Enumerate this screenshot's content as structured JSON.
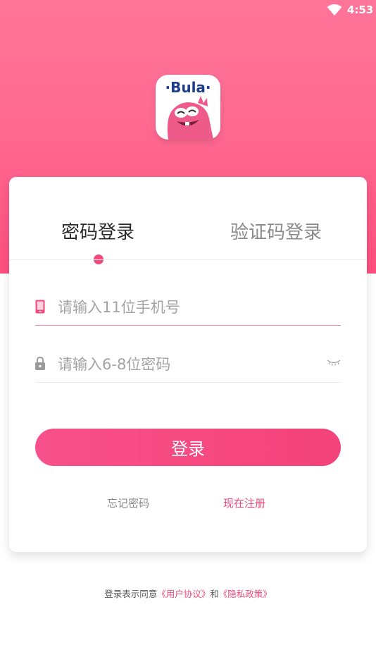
{
  "status_bar": {
    "time": "4:53"
  },
  "logo": {
    "text": "·Bula·"
  },
  "tabs": [
    {
      "label": "密码登录",
      "active": true
    },
    {
      "label": "验证码登录",
      "active": false
    }
  ],
  "phone_field": {
    "placeholder": "请输入11位手机号",
    "value": ""
  },
  "password_field": {
    "placeholder": "请输入6-8位密码",
    "value": ""
  },
  "login_button": {
    "label": "登录"
  },
  "links": {
    "forgot": "忘记密码",
    "register": "现在注册"
  },
  "agreement": {
    "prefix": "登录表示同意",
    "user_agreement": "《用户协议》",
    "and": "和",
    "privacy_policy": "《隐私政策》"
  },
  "colors": {
    "accent": "#f2487a",
    "hero_top": "#ff7499",
    "hero_bottom": "#fd4f80"
  }
}
